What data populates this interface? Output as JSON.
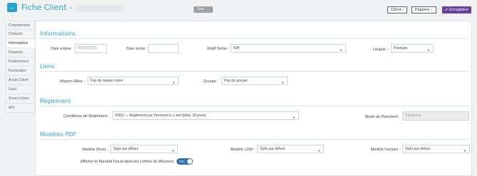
{
  "header": {
    "back_icon": "arrow-left-icon",
    "title": "Fiche Client -",
    "next_label": "Suiv.",
    "next_icon": "arrow-right-icon",
    "client_label": "Client",
    "pappers_label": "Pappers",
    "save_label": "Enregistrer",
    "save_icon": "check-icon",
    "accent": "#2aa3c9",
    "save_color": "#6a3ea1"
  },
  "sidebar": {
    "items": [
      {
        "label": "Coordonnées"
      },
      {
        "label": "Contacts"
      },
      {
        "label": "Informations"
      },
      {
        "label": "Finances"
      },
      {
        "label": "Prélèvement"
      },
      {
        "label": "Facturation"
      },
      {
        "label": "Accès Client"
      },
      {
        "label": "Suivi"
      },
      {
        "label": "Zones Libres"
      },
      {
        "label": "API"
      }
    ],
    "active": "Informations"
  },
  "informations": {
    "heading": "Informations",
    "date_entree_label": "Date entrée",
    "date_entree_value": "05/05/2021",
    "date_sortie_label": "Date sortie",
    "date_sortie_value": "",
    "motif_label": "Motif Sortie :",
    "motif_value": "N/A",
    "langue_label": "Langue :",
    "langue_value": "Français"
  },
  "liens": {
    "heading": "Liens",
    "maison_label": "Maison Mère :",
    "maison_value": "Pas de maison mère",
    "groupe_label": "Groupe :",
    "groupe_value": "Pas de groupe"
  },
  "reglement": {
    "heading": "Règlement",
    "conditions_label": "Conditions de Règlement :",
    "conditions_value": "R002 — Règlement par Virement le 1 net (délai: 30 jours)",
    "mode_label": "Mode de Paiement :",
    "mode_value": "Virement"
  },
  "modeles": {
    "heading": "Modèles PDF",
    "devis_label": "Modèle Devis :",
    "devis_value": "Style par défaut",
    "ldm_label": "Modèle LDM :",
    "ldm_value": "Style par défaut",
    "facture_label": "Modèle Facture :",
    "facture_value": "Style par défaut",
    "mandat_label": "Afficher le Mandat Fiscal dans les Lettres de Missions",
    "mandat_toggle": "ON"
  }
}
